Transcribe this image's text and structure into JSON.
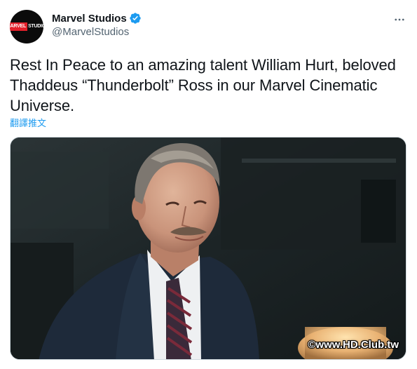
{
  "author": {
    "display_name": "Marvel Studios",
    "handle": "@MarvelStudios",
    "verified": true,
    "verified_color": "#1d9bf0",
    "avatar_logo": {
      "red_part": "MARVEL",
      "white_part": "STUDIOS"
    }
  },
  "menu_icon": "more-horizontal-icon",
  "tweet": {
    "text": "Rest In Peace to an amazing talent William Hurt, beloved Thaddeus “Thunderbolt” Ross in our Marvel Cinematic Universe.",
    "translate_label": "翻譯推文"
  },
  "media": {
    "watermark": "©www.HD.Club.tw"
  },
  "colors": {
    "text": "#0f1419",
    "secondary": "#536471",
    "link": "#1d9bf0",
    "brand_red": "#e4202a"
  }
}
